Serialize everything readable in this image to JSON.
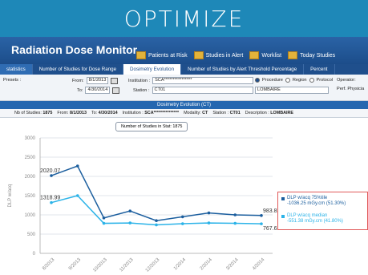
{
  "banner": {
    "title": "OPTIMIZE"
  },
  "app": {
    "title": "Radiation Dose Monitor",
    "nav": [
      "Patients at Risk",
      "Studies in Alert",
      "Worklist",
      "Today Studies"
    ]
  },
  "tabs": [
    "statistics",
    "Number of Studies for Dose Range",
    "Dosimetry Evolution",
    "Number of Studies by Alert Threshold Percentage",
    "Percent"
  ],
  "active_tab": "Dosimetry Evolution",
  "filters": {
    "presets_label": "Presets :",
    "from_label": "From:",
    "from_value": "8/1/2013",
    "to_label": "To:",
    "to_value": "4/30/2014",
    "institution_label": "Institution :",
    "institution_value": "SCA****************",
    "station_label": "Station :",
    "station_value": "CT01",
    "procedure_label": "Procedure",
    "region_label": "Region",
    "protocol_label": "Protocol",
    "procedure_value": "LOMBAIRE",
    "operator_label": "Operator:",
    "perf_label": "Perf. Physicia"
  },
  "evolution_title": "Dosimetry Evolution (CT)",
  "summary": {
    "nb_label": "Nb of Studies:",
    "nb_value": "1875",
    "from_label": "From:",
    "from_value": "8/1/2013",
    "to_label": "To:",
    "to_value": "4/30/2014",
    "institution_label": "Institution :",
    "institution_value": "SCA***************",
    "modality_label": "Modality:",
    "modality_value": "CT",
    "station_label": "Station :",
    "station_value": "CT01",
    "description_label": "Description :",
    "description_value": "LOMBAIRE"
  },
  "nb_box": "Number of Studies in Stat: 1875",
  "chart_data": {
    "type": "line",
    "ylabel": "DLP w/acq",
    "ylim": [
      0,
      3000
    ],
    "yticks": [
      0,
      500,
      1000,
      1500,
      2000,
      2500,
      3000
    ],
    "categories": [
      "8/2013",
      "9/2013",
      "10/2013",
      "11/2013",
      "12/2013",
      "1/2014",
      "2/2014",
      "3/2014",
      "4/2014"
    ],
    "series": [
      {
        "name": "DLP w/acq 75%tile",
        "values": [
          2020.07,
          2270,
          920,
          1100,
          850,
          950,
          1050,
          1000,
          983.82
        ],
        "color": "#1b5e9e"
      },
      {
        "name": "DLP w/acq median",
        "values": [
          1318.99,
          1500,
          780,
          790,
          740,
          770,
          790,
          780,
          767.61
        ],
        "color": "#2bb3e8"
      }
    ],
    "point_labels": [
      {
        "series": 0,
        "index": 0,
        "text": "2020.07"
      },
      {
        "series": 1,
        "index": 0,
        "text": "1318.99"
      },
      {
        "series": 0,
        "index": 8,
        "text": "983.82"
      },
      {
        "series": 1,
        "index": 8,
        "text": "767.61"
      }
    ],
    "legend": [
      {
        "line1": "DLP w/acq 75%tile",
        "line2": "-1036.25 mGy.cm (51.30%)",
        "color": "#1b5e9e"
      },
      {
        "line1": "DLP w/acq median",
        "line2": "-551.38 mGy.cm (41.80%)",
        "color": "#2bb3e8"
      }
    ],
    "grid": true,
    "legend_position": "right"
  }
}
